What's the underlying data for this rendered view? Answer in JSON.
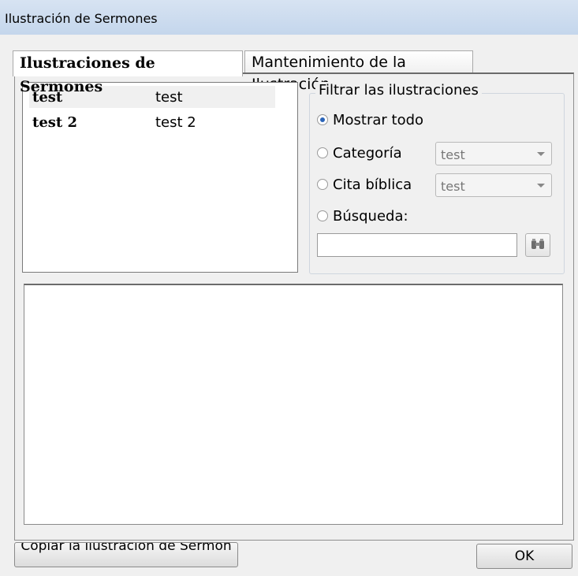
{
  "window": {
    "title": "Ilustración de Sermones"
  },
  "tabs": [
    {
      "label": "Ilustraciones de Sermones",
      "active": true
    },
    {
      "label": "Mantenimiento de la Ilustración",
      "active": false
    }
  ],
  "list": {
    "rows": [
      {
        "name": "test",
        "value": "test",
        "selected": true
      },
      {
        "name": "test 2",
        "value": "test 2",
        "selected": false
      }
    ]
  },
  "filter": {
    "legend": "Filtrar las ilustraciones",
    "show_all": "Mostrar todo",
    "category": "Categoría",
    "category_value": "test",
    "citation": "Cita bíblica",
    "citation_value": "test",
    "search": "Búsqueda:",
    "search_value": "",
    "selected": "show_all"
  },
  "buttons": {
    "copy": "Copiar la ilustración de Sermón",
    "ok": "OK"
  },
  "icons": {
    "search_button": "binoculars-icon"
  }
}
